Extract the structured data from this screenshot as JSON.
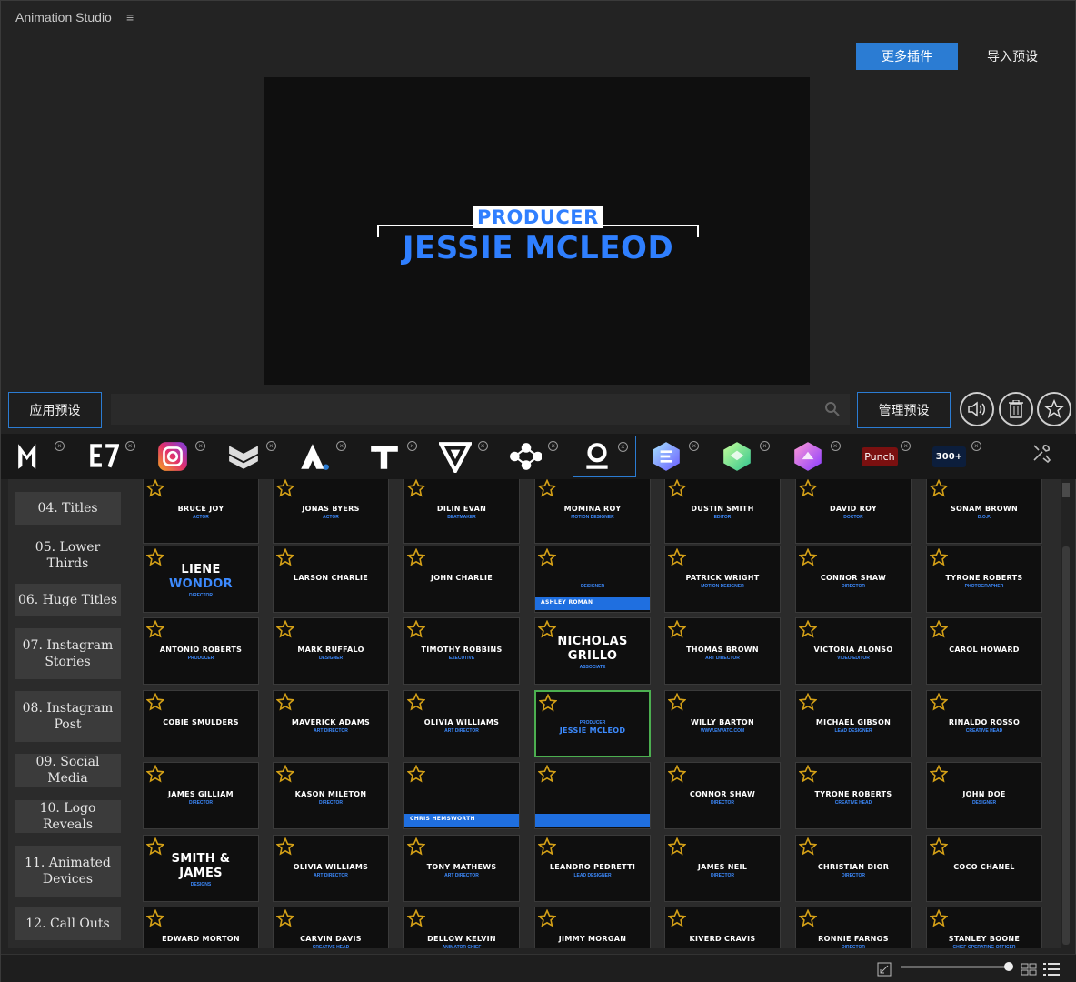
{
  "app": {
    "title": "Animation Studio"
  },
  "toolbar": {
    "more_plugins": "更多插件",
    "import_presets": "导入预设"
  },
  "preview": {
    "role": "PRODUCER",
    "name": "JESSIE MCLEOD"
  },
  "actions": {
    "apply": "应用预设",
    "manage": "管理预设",
    "search_placeholder": ""
  },
  "colors": {
    "accent": "#2b7cd3",
    "title_blue": "#2f7fff",
    "star": "#d4a017",
    "selected_tile": "#4caf50"
  },
  "plugins": [
    {
      "icon": "m-logo-icon"
    },
    {
      "icon": "e7-logo-icon"
    },
    {
      "icon": "instagram-icon"
    },
    {
      "icon": "chevron-badge-icon"
    },
    {
      "icon": "a-logo-icon"
    },
    {
      "icon": "t-logo-icon"
    },
    {
      "icon": "v-logo-icon"
    },
    {
      "icon": "nodes-icon"
    },
    {
      "icon": "o-logo-icon"
    },
    {
      "icon": "cube-blue-icon"
    },
    {
      "icon": "cube-green-icon"
    },
    {
      "icon": "cube-pink-icon"
    },
    {
      "label": "Punch"
    },
    {
      "label": "300+"
    }
  ],
  "categories": [
    {
      "label": "04. Titles"
    },
    {
      "label": "05. Lower Thirds",
      "plain": true
    },
    {
      "label": "06. Huge Titles"
    },
    {
      "label": "07. Instagram Stories"
    },
    {
      "label": "08. Instagram Post"
    },
    {
      "label": "09. Social Media"
    },
    {
      "label": "10. Logo Reveals"
    },
    {
      "label": "11. Animated Devices"
    },
    {
      "label": "12. Call Outs"
    }
  ],
  "tiles": [
    [
      {
        "t": "BRUCE JOY",
        "s": "ACTOR"
      },
      {
        "t": "JONAS BYERS",
        "s": "ACTOR"
      },
      {
        "t": "DILIN EVAN",
        "s": "BEATMAKER"
      },
      {
        "t": "MOMINA ROY",
        "s": "MOTION DESIGNER"
      },
      {
        "t": "DUSTIN SMITH",
        "s": "EDITOR"
      },
      {
        "t": "DAVID ROY",
        "s": "DOCTOR"
      },
      {
        "t": "SONAM BROWN",
        "s": "D.O.P."
      }
    ],
    [
      {
        "t": "LIENE",
        "t2": "WONDOR",
        "s": "DIRECTOR"
      },
      {
        "t": "LARSON CHARLIE",
        "s": ""
      },
      {
        "t": "JOHN CHARLIE",
        "s": ""
      },
      {
        "t": "ASHLEY ROMAN",
        "s": "DESIGNER"
      },
      {
        "t": "PATRICK WRIGHT",
        "s": "MOTION DESIGNER"
      },
      {
        "t": "CONNOR SHAW",
        "s": "DIRECTOR"
      },
      {
        "t": "TYRONE ROBERTS",
        "s": "PHOTOGRAPHER"
      }
    ],
    [
      {
        "t": "ANTONIO ROBERTS",
        "s": "PRODUCER"
      },
      {
        "t": "MARK RUFFALO",
        "s": "DESIGNER"
      },
      {
        "t": "TIMOTHY ROBBINS",
        "s": "EXECUTIVE"
      },
      {
        "t": "NICHOLAS",
        "t2": "GRILLO",
        "s": "ASSOCIATE"
      },
      {
        "t": "THOMAS BROWN",
        "s": "ART DIRECTOR"
      },
      {
        "t": "VICTORIA ALONSO",
        "s": "VIDEO EDITOR"
      },
      {
        "t": "CAROL HOWARD",
        "s": ""
      }
    ],
    [
      {
        "t": "COBIE SMULDERS",
        "s": ""
      },
      {
        "t": "MAVERICK ADAMS",
        "s": "ART DIRECTOR"
      },
      {
        "t": "OLIVIA WILLIAMS",
        "s": "ART DIRECTOR"
      },
      {
        "t": "JESSIE MCLEOD",
        "s": "PRODUCER",
        "selected": true
      },
      {
        "t": "WILLY BARTON",
        "s": "WWW.ENVATO.COM"
      },
      {
        "t": "MICHAEL GIBSON",
        "s": "LEAD DESIGNER"
      },
      {
        "t": "RINALDO ROSSO",
        "s": "CREATIVE HEAD"
      }
    ],
    [
      {
        "t": "JAMES GILLIAM",
        "s": "DIRECTOR"
      },
      {
        "t": "KASON MILETON",
        "s": "DIRECTOR"
      },
      {
        "t": "CHRIS HEMSWORTH",
        "s": ""
      },
      {
        "t": "",
        "s": ""
      },
      {
        "t": "CONNOR SHAW",
        "s": "DIRECTOR"
      },
      {
        "t": "TYRONE ROBERTS",
        "s": "CREATIVE HEAD"
      },
      {
        "t": "JOHN DOE",
        "s": "DESIGNER"
      }
    ],
    [
      {
        "t": "SMITH &",
        "t2": "JAMES",
        "s": "DESIGNS"
      },
      {
        "t": "OLIVIA WILLIAMS",
        "s": "ART DIRECTOR"
      },
      {
        "t": "TONY MATHEWS",
        "s": "ART DIRECTOR"
      },
      {
        "t": "LEANDRO PEDRETTI",
        "s": "LEAD DESIGNER"
      },
      {
        "t": "JAMES NEIL",
        "s": "DIRECTOR"
      },
      {
        "t": "CHRISTIAN DIOR",
        "s": "DIRECTOR"
      },
      {
        "t": "COCO CHANEL",
        "s": ""
      }
    ],
    [
      {
        "t": "EDWARD MORTON",
        "s": ""
      },
      {
        "t": "CARVIN DAVIS",
        "s": "CREATIVE HEAD"
      },
      {
        "t": "DELLOW KELVIN",
        "s": "ANIMATOR CHIEF"
      },
      {
        "t": "JIMMY MORGAN",
        "s": ""
      },
      {
        "t": "KIVERD CRAVIS",
        "s": ""
      },
      {
        "t": "RONNIE FARNOS",
        "s": "DIRECTOR"
      },
      {
        "t": "STANLEY BOONE",
        "s": "CHIEF OPERATING OFFICER"
      }
    ]
  ]
}
